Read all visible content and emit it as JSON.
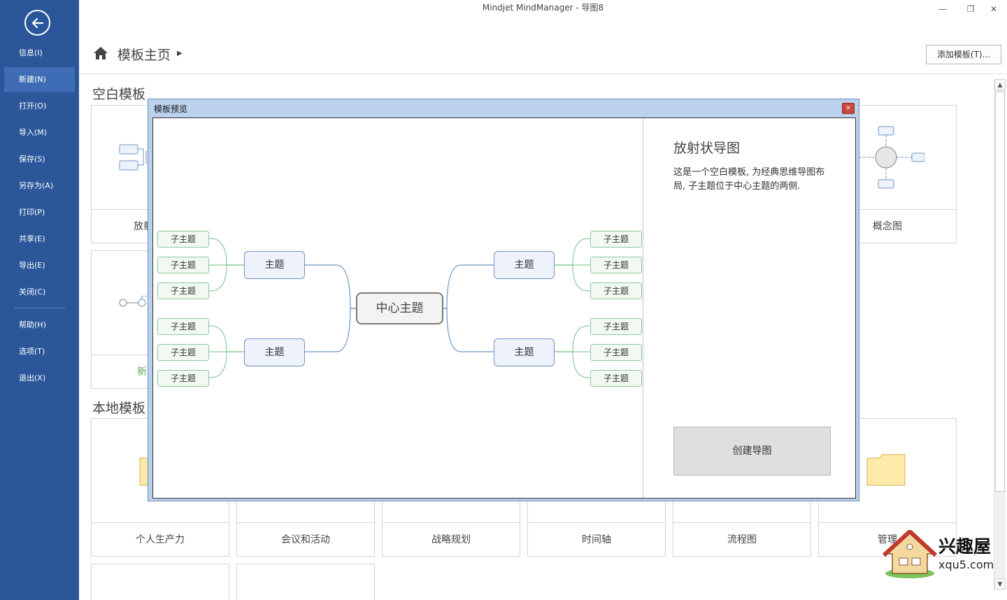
{
  "window": {
    "title": "Mindjet MindManager - 导图8"
  },
  "sidebar": {
    "items": [
      {
        "label": "信息(I)"
      },
      {
        "label": "新建(N)",
        "active": true
      },
      {
        "label": "打开(O)"
      },
      {
        "label": "导入(M)"
      },
      {
        "label": "保存(S)"
      },
      {
        "label": "另存为(A)"
      },
      {
        "label": "打印(P)"
      },
      {
        "label": "共享(E)"
      },
      {
        "label": "导出(E)"
      },
      {
        "label": "关闭(C)"
      }
    ],
    "items2": [
      {
        "label": "帮助(H)"
      },
      {
        "label": "选项(T)"
      },
      {
        "label": "退出(X)"
      }
    ]
  },
  "header": {
    "title": "模板主页",
    "add_template": "添加模板(T)..."
  },
  "sections": {
    "blank_title": "空白模板",
    "local_title": "本地模板",
    "blank_card_1": "放射",
    "blank_card_last": "概念图",
    "blank_card_new": "新",
    "local_cards": [
      "个人生产力",
      "会议和活动",
      "战略规划",
      "时间轴",
      "流程图",
      "管理"
    ]
  },
  "dialog": {
    "title": "模板预览",
    "close": "×",
    "info_title": "放射状导图",
    "info_desc": "这是一个空白模板, 为经典思维导图布局, 子主题位于中心主题的两侧.",
    "create_button": "创建导图",
    "map": {
      "central": "中心主题",
      "main": [
        "主题",
        "主题",
        "主题",
        "主题"
      ],
      "sub": "子主题"
    }
  },
  "watermark": {
    "name": "兴趣屋",
    "url": "xqu5.com"
  },
  "colors": {
    "sidebar": "#2b579a",
    "sidebar_active": "#3e6db5",
    "dialog_frame": "#bcd1ec"
  }
}
